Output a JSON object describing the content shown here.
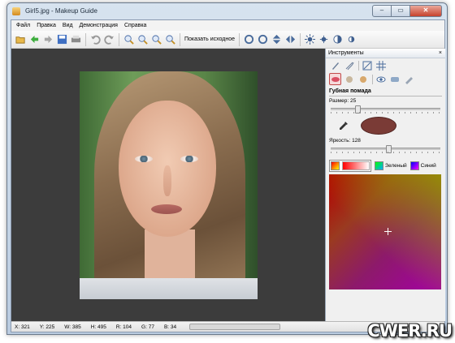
{
  "window": {
    "title": "Girl5.jpg - Makeup Guide",
    "minimize": "–",
    "maximize": "▭",
    "close": "✕"
  },
  "menu": [
    "Файл",
    "Правка",
    "Вид",
    "Демонстрация",
    "Справка"
  ],
  "toolbar": {
    "show_original": "Показать исходное"
  },
  "panel": {
    "title": "Инструменты",
    "close": "×",
    "section_title": "Губная помада",
    "size_label": "Размер: 25",
    "size_value": 25,
    "brightness_label": "Яркость: 128",
    "brightness_value": 128,
    "swatch_color": "#7a3b36",
    "tabs": [
      "Зеленый",
      "Синий"
    ]
  },
  "status": [
    "X: 321",
    "Y: 225",
    "W: 385",
    "H: 495",
    "R: 104",
    "G: 77",
    "B: 34"
  ],
  "watermark": "CWER.RU"
}
